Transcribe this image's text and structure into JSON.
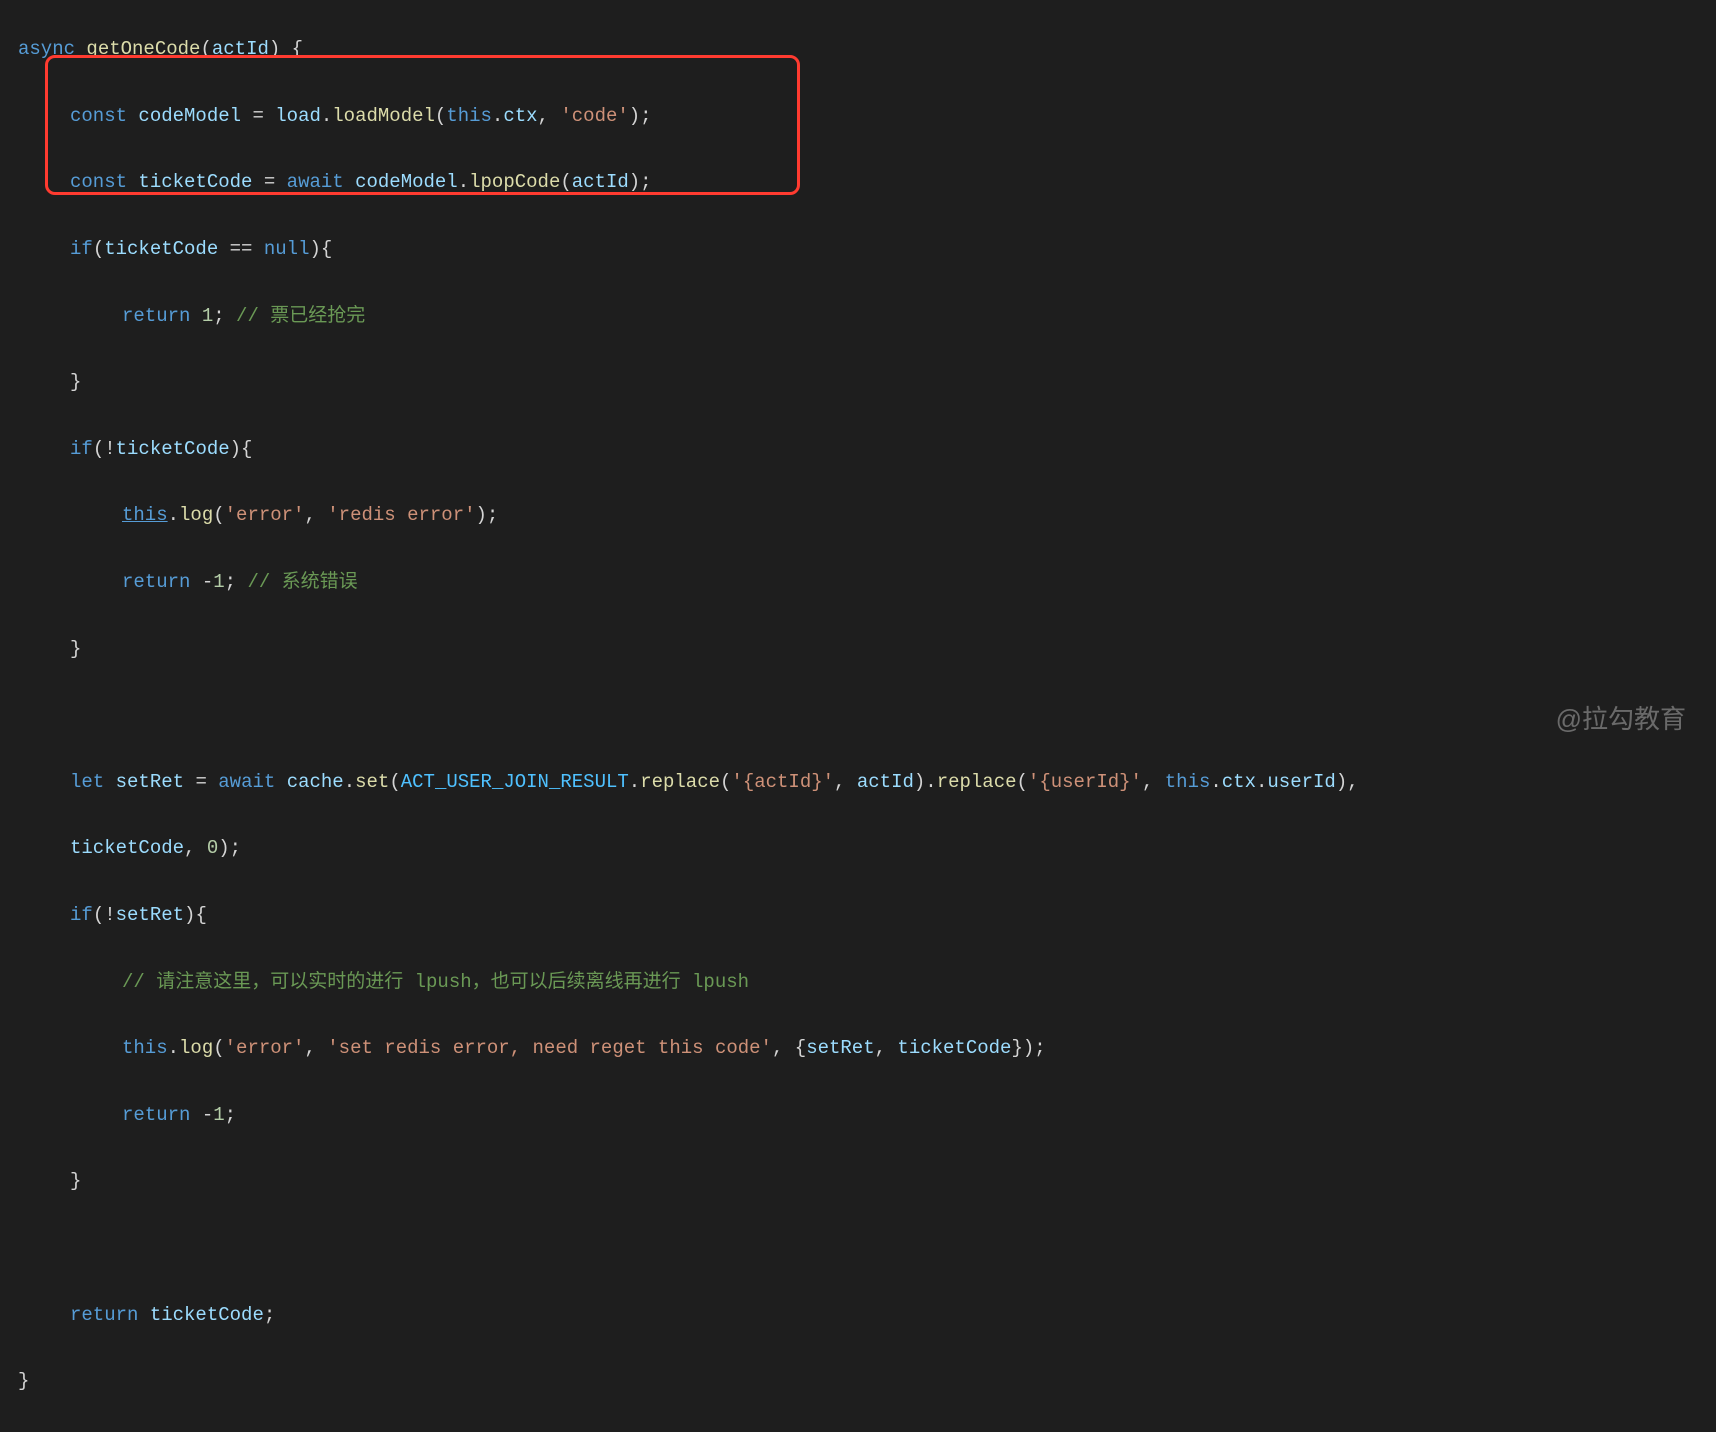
{
  "code": {
    "l1_async": "async",
    "l1_fn": "getOneCode",
    "l1_param": "actId",
    "l2_const": "const",
    "l2_codeModel": "codeModel",
    "l2_load": "load",
    "l2_loadModel": "loadModel",
    "l2_this": "this",
    "l2_ctx": "ctx",
    "l2_str": "'code'",
    "l3_const": "const",
    "l3_ticketCode": "ticketCode",
    "l3_await": "await",
    "l3_codeModel": "codeModel",
    "l3_lpopCode": "lpopCode",
    "l3_actId": "actId",
    "l4_if": "if",
    "l4_ticketCode": "ticketCode",
    "l4_eq": "==",
    "l4_null": "null",
    "l5_return": "return",
    "l5_val": "1",
    "l5_cmt": "// 票已经抢完",
    "l6_brace": "}",
    "l7_if": "if",
    "l7_not": "!",
    "l7_ticketCode": "ticketCode",
    "l8_this": "this",
    "l8_log": "log",
    "l8_s1": "'error'",
    "l8_s2": "'redis error'",
    "l9_return": "return",
    "l9_val": "-1",
    "l9_cmt": "// 系统错误",
    "l10_brace": "}",
    "l12_let": "let",
    "l12_setRet": "setRet",
    "l12_await": "await",
    "l12_cache": "cache",
    "l12_set": "set",
    "l12_const1": "ACT_USER_JOIN_RESULT",
    "l12_replace": "replace",
    "l12_s1": "'{actId}'",
    "l12_actId": "actId",
    "l12_s2": "'{userId}'",
    "l12_this": "this",
    "l12_ctx": "ctx",
    "l12_userId": "userId",
    "l13_ticketCode": "ticketCode",
    "l13_zero": "0",
    "l14_if": "if",
    "l14_not": "!",
    "l14_setRet": "setRet",
    "l15_cmt": "// 请注意这里，可以实时的进行 lpush，也可以后续离线再进行 lpush",
    "l16_this": "this",
    "l16_log": "log",
    "l16_s1": "'error'",
    "l16_s2": "'set redis error, need reget this code'",
    "l16_setRet": "setRet",
    "l16_ticketCode": "ticketCode",
    "l17_return": "return",
    "l17_val": "-1",
    "l18_brace": "}",
    "l20_return": "return",
    "l20_ticketCode": "ticketCode",
    "l21_brace": "}"
  },
  "watermark": "@拉勾教育"
}
